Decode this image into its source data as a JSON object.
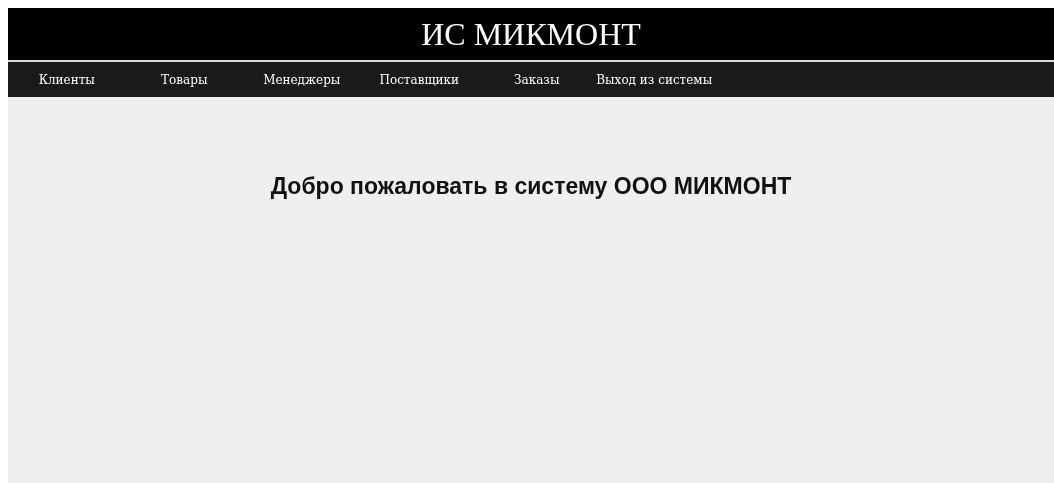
{
  "header": {
    "title": "ИС МИКМОНТ"
  },
  "nav": [
    {
      "label": "Клиенты"
    },
    {
      "label": "Товары"
    },
    {
      "label": "Менеджеры"
    },
    {
      "label": "Поставщики"
    },
    {
      "label": "Заказы"
    },
    {
      "label": "Выход из системы"
    }
  ],
  "main": {
    "heading": "Добро пожаловать в систему ООО МИКМОНТ"
  }
}
